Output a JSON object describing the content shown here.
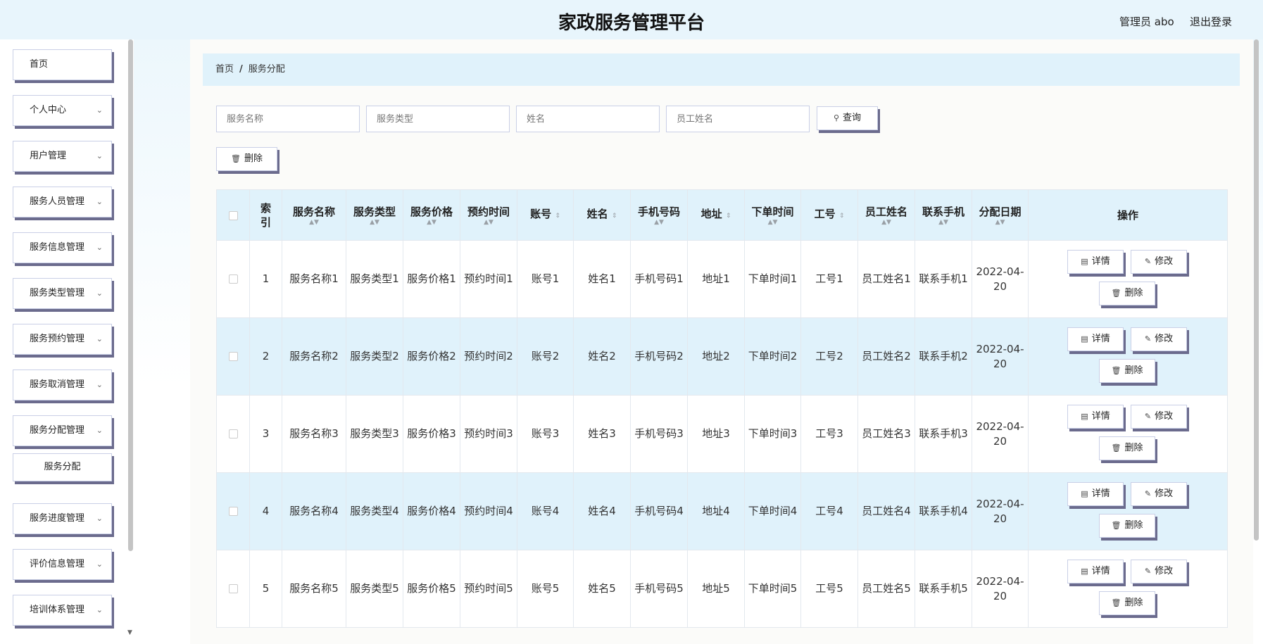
{
  "header": {
    "title": "家政服务管理平台",
    "user": "管理员 abo",
    "logout": "退出登录"
  },
  "sidebar": {
    "items": [
      {
        "label": "首页",
        "chevron": false
      },
      {
        "label": "个人中心",
        "chevron": true
      },
      {
        "label": "用户管理",
        "chevron": true
      },
      {
        "label": "服务人员管理",
        "chevron": true
      },
      {
        "label": "服务信息管理",
        "chevron": true
      },
      {
        "label": "服务类型管理",
        "chevron": true
      },
      {
        "label": "服务预约管理",
        "chevron": true
      },
      {
        "label": "服务取消管理",
        "chevron": true
      },
      {
        "label": "服务分配管理",
        "chevron": true
      },
      {
        "label": "服务进度管理",
        "chevron": true
      },
      {
        "label": "评价信息管理",
        "chevron": true
      },
      {
        "label": "培训体系管理",
        "chevron": true
      }
    ],
    "sub_item": "服务分配"
  },
  "breadcrumb": {
    "home": "首页",
    "sep": "/",
    "current": "服务分配"
  },
  "search": {
    "fields": [
      {
        "placeholder": "服务名称"
      },
      {
        "placeholder": "服务类型"
      },
      {
        "placeholder": "姓名"
      },
      {
        "placeholder": "员工姓名"
      }
    ],
    "query_label": "查询"
  },
  "toolbar": {
    "delete_label": "删除"
  },
  "table": {
    "columns": [
      "索引",
      "服务名称",
      "服务类型",
      "服务价格",
      "预约时间",
      "账号",
      "姓名",
      "手机号码",
      "地址",
      "下单时间",
      "工号",
      "员工姓名",
      "联系手机",
      "分配日期",
      "操作"
    ],
    "rows": [
      {
        "idx": "1",
        "name": "服务名称1",
        "type": "服务类型1",
        "price": "服务价格1",
        "time": "预约时间1",
        "account": "账号1",
        "person": "姓名1",
        "phone": "手机号码1",
        "addr": "地址1",
        "order_time": "下单时间1",
        "emp_no": "工号1",
        "emp_name": "员工姓名1",
        "contact": "联系手机1",
        "date": "2022-04-20"
      },
      {
        "idx": "2",
        "name": "服务名称2",
        "type": "服务类型2",
        "price": "服务价格2",
        "time": "预约时间2",
        "account": "账号2",
        "person": "姓名2",
        "phone": "手机号码2",
        "addr": "地址2",
        "order_time": "下单时间2",
        "emp_no": "工号2",
        "emp_name": "员工姓名2",
        "contact": "联系手机2",
        "date": "2022-04-20"
      },
      {
        "idx": "3",
        "name": "服务名称3",
        "type": "服务类型3",
        "price": "服务价格3",
        "time": "预约时间3",
        "account": "账号3",
        "person": "姓名3",
        "phone": "手机号码3",
        "addr": "地址3",
        "order_time": "下单时间3",
        "emp_no": "工号3",
        "emp_name": "员工姓名3",
        "contact": "联系手机3",
        "date": "2022-04-20"
      },
      {
        "idx": "4",
        "name": "服务名称4",
        "type": "服务类型4",
        "price": "服务价格4",
        "time": "预约时间4",
        "account": "账号4",
        "person": "姓名4",
        "phone": "手机号码4",
        "addr": "地址4",
        "order_time": "下单时间4",
        "emp_no": "工号4",
        "emp_name": "员工姓名4",
        "contact": "联系手机4",
        "date": "2022-04-20"
      },
      {
        "idx": "5",
        "name": "服务名称5",
        "type": "服务类型5",
        "price": "服务价格5",
        "time": "预约时间5",
        "account": "账号5",
        "person": "姓名5",
        "phone": "手机号码5",
        "addr": "地址5",
        "order_time": "下单时间5",
        "emp_no": "工号5",
        "emp_name": "员工姓名5",
        "contact": "联系手机5",
        "date": "2022-04-20"
      }
    ],
    "actions": {
      "detail": "详情",
      "edit": "修改",
      "delete": "删除"
    }
  },
  "icons": {
    "search": "search-icon",
    "delete": "trash-icon",
    "detail": "document-icon",
    "edit": "pencil-icon",
    "chevron": "chevron-down-icon"
  }
}
